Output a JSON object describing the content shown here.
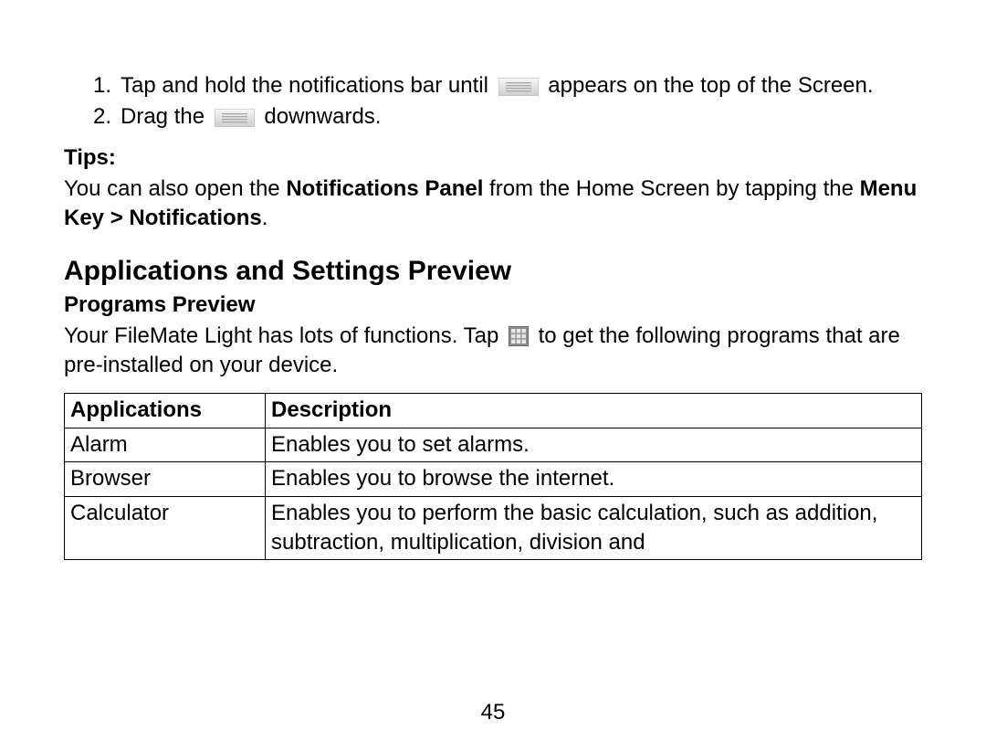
{
  "list": {
    "item1_a": "Tap and hold the notifications bar until ",
    "item1_b": " appears on the top of the Screen.",
    "item2_a": "Drag the ",
    "item2_b": " downwards."
  },
  "tips_label": "Tips:",
  "tips_body_a": "You can also open the ",
  "tips_body_b": "Notifications Panel",
  "tips_body_c": " from the Home Screen by tapping the ",
  "tips_body_d": "Menu Key > Notifications",
  "tips_body_e": ".",
  "section_heading": "Applications and Settings Preview",
  "programs_preview_label": "Programs Preview",
  "programs_body_a": "Your FileMate Light has lots of functions. Tap ",
  "programs_body_b": " to get the following programs that are pre-installed on your device.",
  "table": {
    "header_app": "Applications",
    "header_desc": "Description",
    "rows": [
      {
        "app": "Alarm",
        "desc": "Enables you to set alarms."
      },
      {
        "app": "Browser",
        "desc": "Enables you to browse the internet."
      },
      {
        "app": "Calculator",
        "desc": "Enables you to perform the basic calculation, such as addition, subtraction, multiplication, division and"
      }
    ]
  },
  "page_number": "45",
  "icons": {
    "drag_handle": "drag-handle-icon",
    "app_grid": "app-grid-icon"
  }
}
